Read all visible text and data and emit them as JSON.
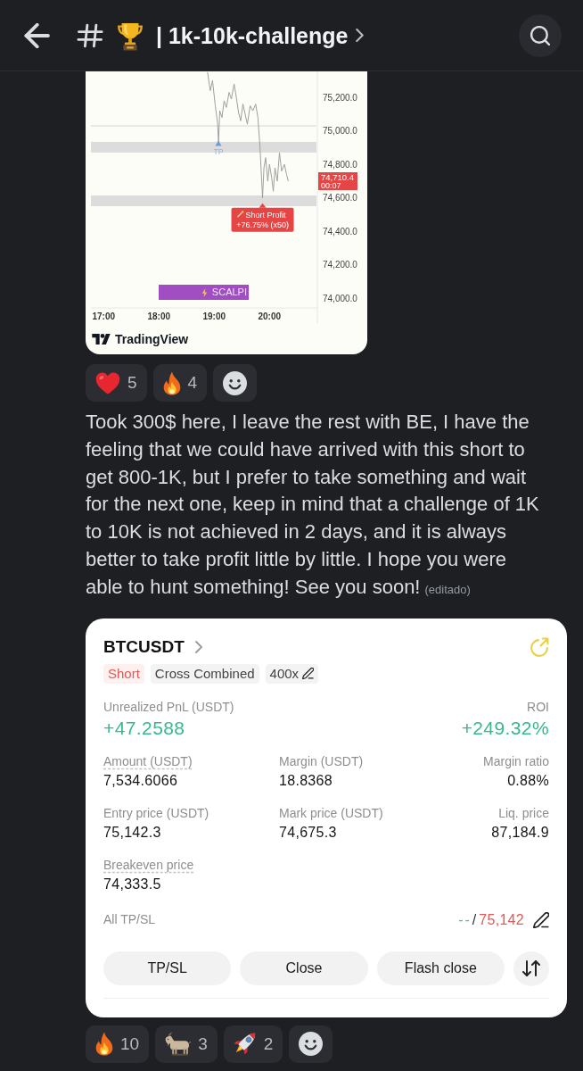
{
  "header": {
    "title": "| 1k-10k-challenge"
  },
  "attachment": {
    "chart_data": {
      "type": "line",
      "x": [
        18.88,
        18.93,
        18.97,
        19.02,
        19.06,
        19.08,
        19.1,
        19.14,
        19.18,
        19.22,
        19.27,
        19.31,
        19.36,
        19.4,
        19.44,
        19.48,
        19.52,
        19.56,
        19.6,
        19.65,
        19.7,
        19.75,
        19.79,
        19.83,
        19.86,
        19.875,
        19.9,
        19.93,
        19.97,
        20.0,
        20.04,
        20.07,
        20.1,
        20.14,
        20.18,
        20.22,
        20.27,
        20.31,
        20.34
      ],
      "series": [
        {
          "color": "#9e9e9e",
          "values": [
            75350,
            75240,
            75300,
            75150,
            75050,
            74930,
            75120,
            75080,
            75180,
            75140,
            75230,
            75190,
            75280,
            75200,
            75110,
            75060,
            75160,
            75100,
            75040,
            75150,
            75120,
            75160,
            75080,
            74900,
            74700,
            74600,
            74780,
            74840,
            74700,
            74800,
            74720,
            74640,
            74780,
            74700,
            74870,
            74760,
            74800,
            74740,
            74700
          ]
        }
      ],
      "xlim": [
        16.77,
        20.85
      ],
      "ylim": [
        73960,
        75355
      ],
      "xticks": [
        {
          "value": 17,
          "label": "17:00"
        },
        {
          "value": 18,
          "label": "18:00"
        },
        {
          "value": 19,
          "label": "19:00"
        },
        {
          "value": 20,
          "label": "20:00"
        }
      ],
      "yticks": [
        {
          "value": 75200,
          "label": "75,200.0"
        },
        {
          "value": 75000,
          "label": "75,000.0"
        },
        {
          "value": 74800,
          "label": "74,800.0"
        },
        {
          "value": 74600,
          "label": "74,600.0"
        },
        {
          "value": 74400,
          "label": "74,400.0"
        },
        {
          "value": 74200,
          "label": "74,200.0"
        },
        {
          "value": 74000,
          "label": "74,000.0"
        }
      ],
      "ref_lines": [
        {
          "axis": "y",
          "value": 75030
        }
      ],
      "bands": [
        {
          "axis": "y",
          "from": 74871,
          "to": 74935
        },
        {
          "axis": "y",
          "from": 74551,
          "to": 74615
        }
      ]
    },
    "marker_label": "TP",
    "callout": {
      "title": "Short Profit",
      "value": "+76.75% (x50)"
    },
    "price_tag": {
      "value": "74,710.4",
      "time": "00:07"
    },
    "indicator_label": "SCALPI",
    "source": "TradingView"
  },
  "reactions": [
    {
      "kind": "heart",
      "count": "5"
    },
    {
      "kind": "fire",
      "count": "4"
    },
    {
      "kind": "add"
    }
  ],
  "message": {
    "text": "Took 300$ here, I leave the rest with BE, I have the feeling that we could have arrived with this short to get 800-1K, but I prefer to take something and wait for the next one, keep in mind that a challenge of 1K to 10K is not achieved in 2 days, and it is always better to take profit little by little. I hope you were able to hunt something! See you soon!",
    "edited": "(editado)"
  },
  "position_card": {
    "symbol": "BTCUSDT",
    "tags": [
      {
        "kind": "side",
        "label": "Short",
        "editable": false
      },
      {
        "kind": "mode",
        "label": "Cross Combined",
        "editable": false
      },
      {
        "kind": "leverage",
        "label": "400x",
        "editable": true
      }
    ],
    "pnl": {
      "label": "Unrealized PnL (USDT)",
      "value": "+47.2588"
    },
    "roi": {
      "label": "ROI",
      "value": "+249.32%"
    },
    "stats": [
      {
        "label": "Amount (USDT)",
        "value": "7,534.6066",
        "underlined": true
      },
      {
        "label": "Margin (USDT)",
        "value": "18.8368",
        "underlined": false
      },
      {
        "label": "Margin ratio",
        "value": "0.88%",
        "underlined": false
      },
      {
        "label": "Entry price (USDT)",
        "value": "75,142.3",
        "underlined": false
      },
      {
        "label": "Mark price (USDT)",
        "value": "74,675.3",
        "underlined": false
      },
      {
        "label": "Liq. price",
        "value": "87,184.9",
        "underlined": false
      },
      {
        "label": "Breakeven price",
        "value": "74,333.5",
        "underlined": true
      }
    ],
    "tpsl": {
      "label": "All TP/SL",
      "take_profit": "--",
      "separator": "/",
      "stop_loss": "75,142"
    },
    "buttons": [
      {
        "label": "TP/SL"
      },
      {
        "label": "Close"
      },
      {
        "label": "Flash close"
      }
    ]
  },
  "card_reactions": [
    {
      "kind": "fire",
      "count": "10"
    },
    {
      "kind": "goat",
      "count": "3"
    },
    {
      "kind": "rocket",
      "count": "2"
    },
    {
      "kind": "add"
    }
  ]
}
